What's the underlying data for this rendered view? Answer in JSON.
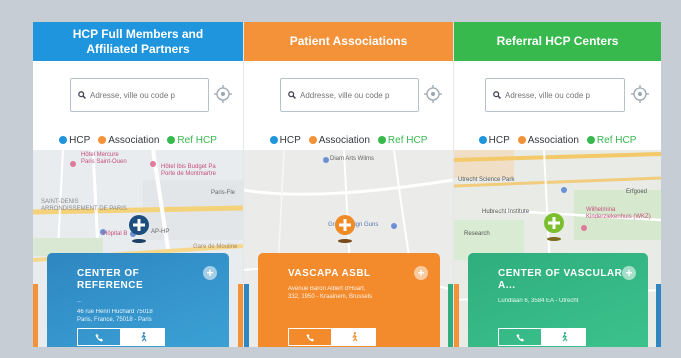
{
  "colors": {
    "hcp_blue": "#1e95dd",
    "association_orange": "#f4923a",
    "referral_green": "#37b94e",
    "hcp_card": "#2f86c1",
    "association_card": "#f38a2b",
    "referral_card": "#2fae7e"
  },
  "filters": [
    {
      "label": "HCP",
      "color": "#1e95dd"
    },
    {
      "label": "Association",
      "color": "#f4923a"
    },
    {
      "label": "Ref HCP",
      "color": "#37b94e"
    }
  ],
  "panels": [
    {
      "header": "HCP Full Members and\nAffiliated Partners",
      "search_placeholder": "Adresse, ville ou code p",
      "map_labels": [
        "Hôtel Mercure\nParis Saint-Ouen",
        "Hôtel Ibis Budget Pa\nPorte de Montmartre",
        "Paris-Fle",
        "SAINT-DENIS",
        "ARRONDISSEMENT DE PARIS",
        "Hôpital B",
        "AP-HP",
        "Gare de Mouline"
      ],
      "card": {
        "title": "CENTER OF REFERENCE",
        "subtitle": "...",
        "address": "46 rue Henri Huchard 75018\nParis, France, 75018 - Paris"
      }
    },
    {
      "header": "Patient Associations",
      "search_placeholder": "Addresse, ville ou code p",
      "map_labels": [
        "Diam Arts Wilms",
        "Groendesign Guns"
      ],
      "card": {
        "title": "VASCAPA ASBL",
        "subtitle": "",
        "address": "Avenue Baron Albert d'Huart,\n332, 1950 - Kraainem, Brussels"
      }
    },
    {
      "header": "Referral HCP Centers",
      "search_placeholder": "Adresse, ville ou code p",
      "map_labels": [
        "Utrecht Science Park",
        "Hubrecht Institute",
        "Wilhelmina\nKinderziekenhuis (WKZ)",
        "Erfgoed",
        "Research"
      ],
      "card": {
        "title": "CENTER OF VASCULAR\nA...",
        "subtitle": "",
        "address": "Lundlaan 6, 3584 EA - Utrecht"
      }
    }
  ]
}
